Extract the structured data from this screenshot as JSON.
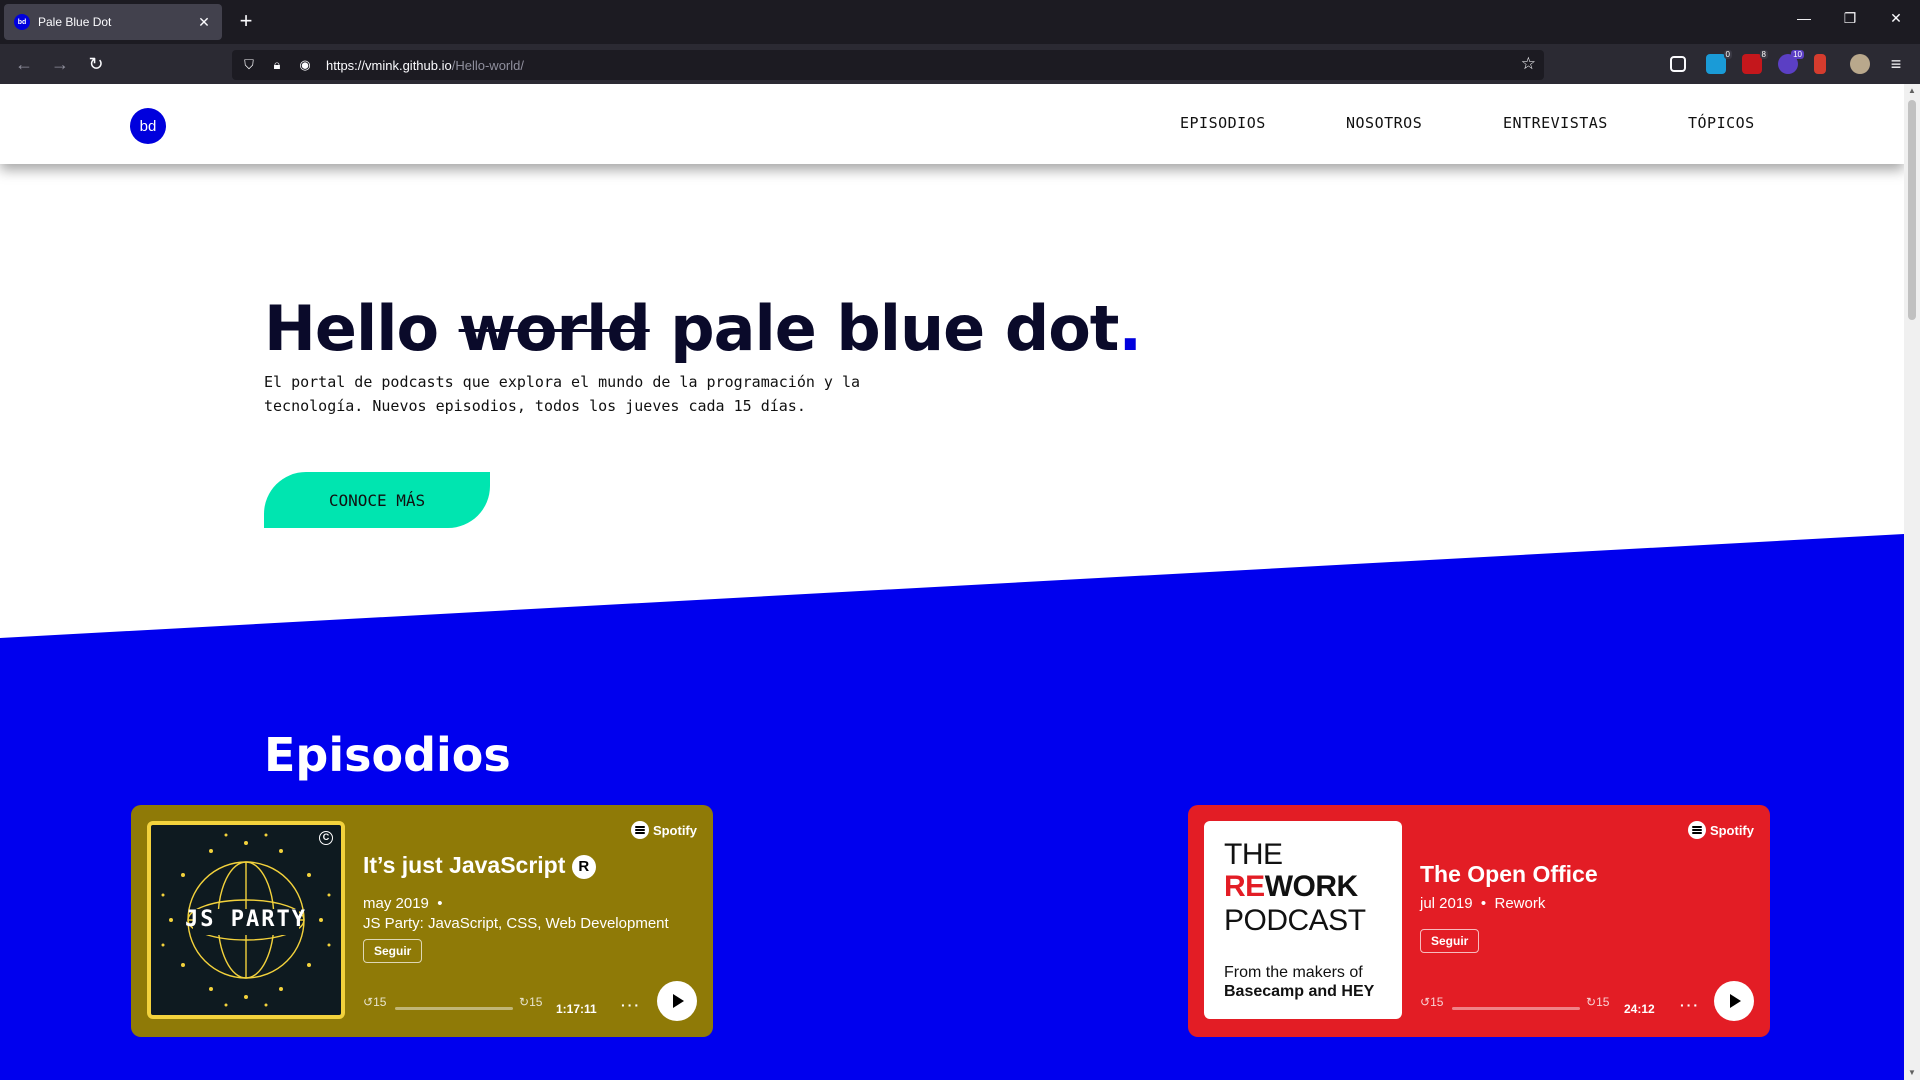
{
  "browser": {
    "tab_title": "Pale Blue Dot",
    "tab_favicon": "bd",
    "url_host": "https://vmink.github.io",
    "url_path": "/Hello-world/",
    "extension_badges": [
      "0",
      "8",
      "10"
    ]
  },
  "site": {
    "logo": "bd",
    "nav": [
      "EPISODIOS",
      "NOSOTROS",
      "ENTREVISTAS",
      "TÓPICOS"
    ],
    "hero": {
      "title_start": "Hello ",
      "title_struck": "world",
      "title_end": " pale blue dot",
      "title_dot": ".",
      "subtitle": "El portal de podcasts que explora el mundo de la programación y la tecnología. Nuevos episodios, todos los jueves cada 15 días.",
      "cta": "CONOCE MÁS"
    },
    "episodes_heading": "Episodios",
    "colors": {
      "accent_blue": "#0000dd",
      "cta_green": "#00e5b0"
    }
  },
  "cards": [
    {
      "brand": "Spotify",
      "title": "It’s just JavaScript",
      "title_mark": "R",
      "date": "may 2019",
      "bullet": "•",
      "show": "",
      "description": "JS Party: JavaScript, CSS, Web Development",
      "follow": "Seguir",
      "skip_back": "15",
      "skip_fwd": "15",
      "duration": "1:17:11",
      "more": "···",
      "art_text": "JS PARTY",
      "art_badge": "C",
      "bg": "#8f7a07"
    },
    {
      "brand": "Spotify",
      "title": "The Open Office",
      "date": "jul 2019",
      "bullet": "•",
      "show": "Rework",
      "follow": "Seguir",
      "skip_back": "15",
      "skip_fwd": "15",
      "duration": "24:12",
      "more": "···",
      "art_lines": [
        "THE",
        "REWORK",
        "PODCAST"
      ],
      "art_red_part": "RE",
      "art_rest": "WORK",
      "art_small": [
        "From the makers of",
        "Basecamp and HEY"
      ],
      "bg": "#e31d25"
    }
  ]
}
